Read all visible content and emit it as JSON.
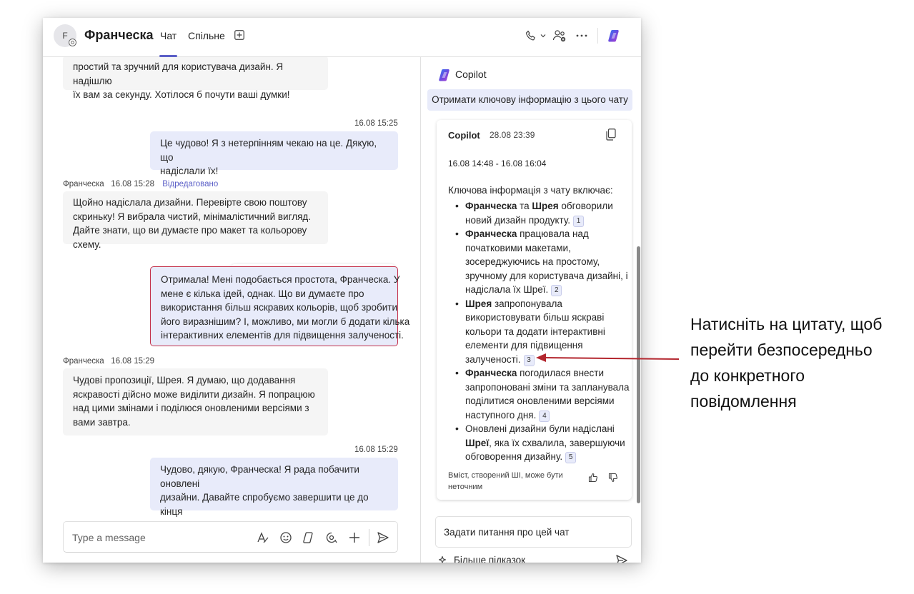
{
  "header": {
    "avatar_initial": "F",
    "title": "Франческа",
    "tab_chat": "Чат",
    "tab_shared": "Спільне"
  },
  "messages": [
    {
      "type": "in",
      "text_lines": [
        "простий та зручний для користувача дизайн. Я надішлю",
        "їх вам за секунду. Хотілося б почути ваші думки!"
      ]
    },
    {
      "type": "out",
      "time": "16.08 15:25",
      "text_lines": [
        "Це чудово! Я з нетерпінням чекаю на це. Дякую, що",
        "надіслали їх!"
      ]
    },
    {
      "type": "in",
      "author": "Франческа",
      "time": "16.08 15:28",
      "edited": "Відредаговано",
      "text_lines": [
        "Щойно надіслала дизайни. Перевірте свою поштову",
        "скриньку! Я вибрала чистий, мінімалістичний вигляд.",
        "Дайте знати, що ви думаєте про макет та кольорову схему."
      ]
    },
    {
      "type": "out",
      "selected": true,
      "text_lines": [
        "Отримала! Мені подобається простота, Франческа. У",
        "мене є кілька ідей, однак. Що ви думаєте про",
        "використання більш яскравих кольорів, щоб зробити",
        "його виразнішим? І, можливо, ми могли б додати кілька",
        "інтерактивних елементів для підвищення залученості."
      ]
    },
    {
      "type": "in",
      "author": "Франческа",
      "time": "16.08 15:29",
      "text_lines": [
        "Чудові пропозиції, Шрея. Я думаю, що додавання",
        "яскравості дійсно може виділити дизайн. Я попрацюю",
        "над цими змінами і поділюся оновленими версіями з",
        "вами завтра."
      ]
    },
    {
      "type": "out",
      "time": "16.08 15:29",
      "text_lines": [
        "Чудово, дякую, Франческа! Я рада побачити оновлені",
        "дизайни. Давайте спробуємо завершити це до кінця",
        "тижня."
      ]
    }
  ],
  "reactions": [
    "👍",
    "❤️",
    "😆",
    "😮"
  ],
  "compose": {
    "placeholder": "Type a message"
  },
  "copilot": {
    "pane_title": "Copilot",
    "prompt": "Отримати ключову інформацію з цього чату",
    "card": {
      "name": "Copilot",
      "time": "28.08 23:39",
      "range": "16.08 14:48 - 16.08 16:04",
      "intro": "Ключова інформація з чату включає:",
      "bullets": [
        {
          "lines": [
            "<b>Франческа</b> та <b>Шрея</b> обговорили",
            "новий дизайн продукту."
          ],
          "cite": "1"
        },
        {
          "lines": [
            "<b>Франческа</b> працювала над",
            "початковими макетами,",
            "зосереджуючись на простому,",
            "зручному для користувача дизайні, і",
            "надіслала їх Шреї."
          ],
          "cite": "2"
        },
        {
          "lines": [
            "<b>Шрея</b> запропонувала",
            "використовувати більш яскраві",
            "кольори та додати інтерактивні",
            "елементи для підвищення",
            "залученості."
          ],
          "cite": "3"
        },
        {
          "lines": [
            "<b>Франческа</b> погодилася внести",
            "запропоновані зміни та запланувала",
            "поділитися оновленими версіями",
            "наступного дня."
          ],
          "cite": "4"
        },
        {
          "lines": [
            "Оновлені дизайни були надіслані",
            "<b>Шреї</b>, яка їх схвалила, завершуючи",
            "обговорення дизайну."
          ],
          "cite": "5"
        }
      ],
      "disclaimer": "Вміст, створений ШІ, може бути неточним"
    },
    "ask_placeholder": "Задати питання про цей чат",
    "more_hints": "Більше підказок"
  },
  "annotation": {
    "lines": [
      "Натисніть на цитату, щоб",
      "перейти безпосередньо",
      "до конкретного",
      "повідомлення"
    ],
    "arrow_color": "#b3262e"
  },
  "colors": {
    "accent": "#5b5fc7",
    "outgoing_bubble": "#e8ebfa",
    "incoming_bubble": "#f5f5f5",
    "selected_border": "#c4314b"
  }
}
